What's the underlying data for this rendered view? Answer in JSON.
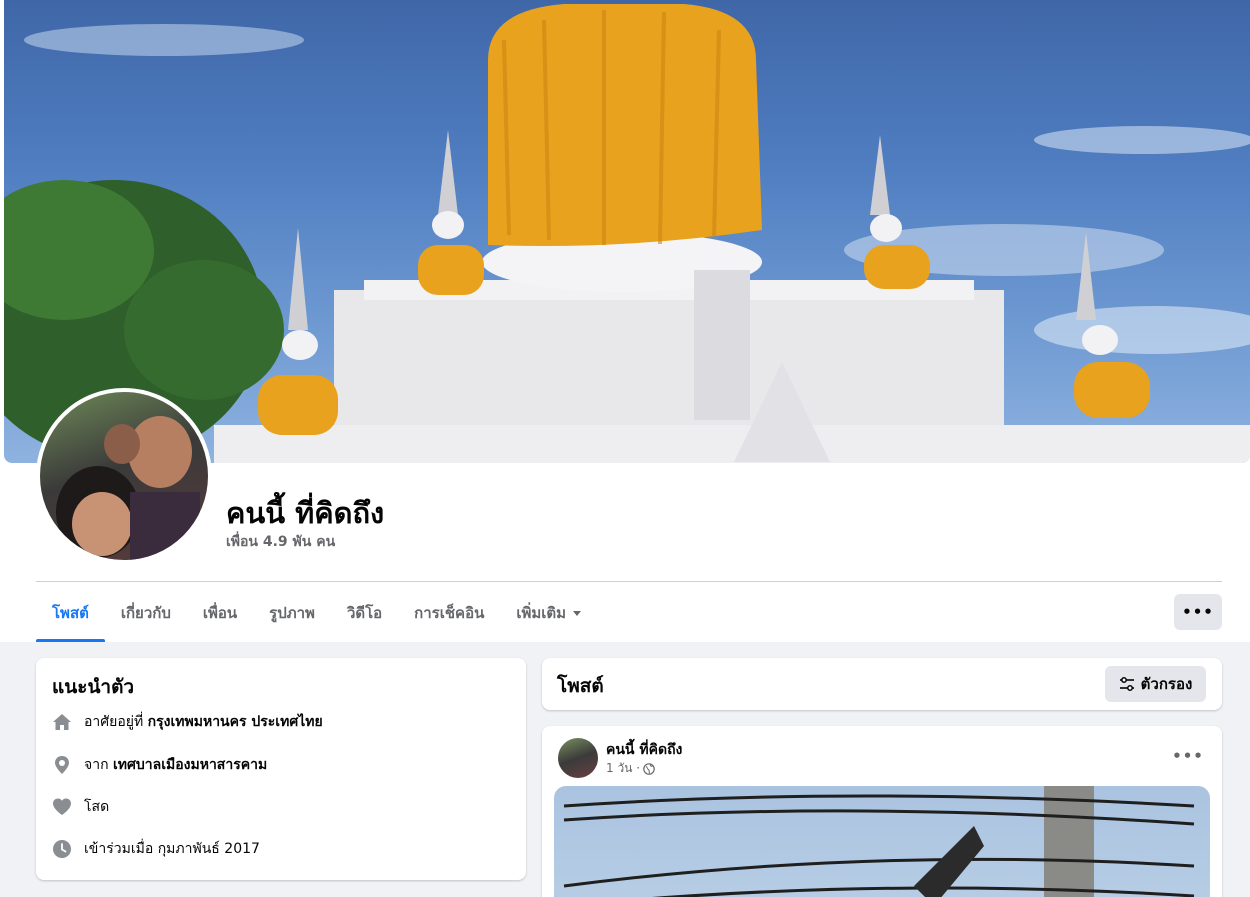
{
  "profile": {
    "name": "คนนี้ ที่คิดถึง",
    "friends": "เพื่อน 4.9 พัน คน"
  },
  "tabs": [
    {
      "label": "โพสต์",
      "active": true
    },
    {
      "label": "เกี่ยวกับ"
    },
    {
      "label": "เพื่อน"
    },
    {
      "label": "รูปภาพ"
    },
    {
      "label": "วิดีโอ"
    },
    {
      "label": "การเช็คอิน"
    },
    {
      "label": "เพิ่มเติม"
    }
  ],
  "more_button": "•••",
  "intro": {
    "title": "แนะนำตัว",
    "lives_prefix": "อาศัยอยู่ที่",
    "lives_value": "กรุงเทพมหานคร ประเทศไทย",
    "from_prefix": "จาก",
    "from_value": "เทศบาลเมืองมหาสารคาม",
    "relationship": "โสด",
    "joined": "เข้าร่วมเมื่อ กุมภาพันธ์ 2017"
  },
  "posts": {
    "title": "โพสต์",
    "filter_label": "ตัวกรอง"
  },
  "post": {
    "author": "คนนี้ ที่คิดถึง",
    "time": "1 วัน ·",
    "more": "•••"
  },
  "colors": {
    "accent": "#1877f2",
    "page_bg": "#f0f2f5",
    "secondary_text": "#65676b",
    "button_bg": "#e4e6eb",
    "gold": "#e9a21d"
  }
}
